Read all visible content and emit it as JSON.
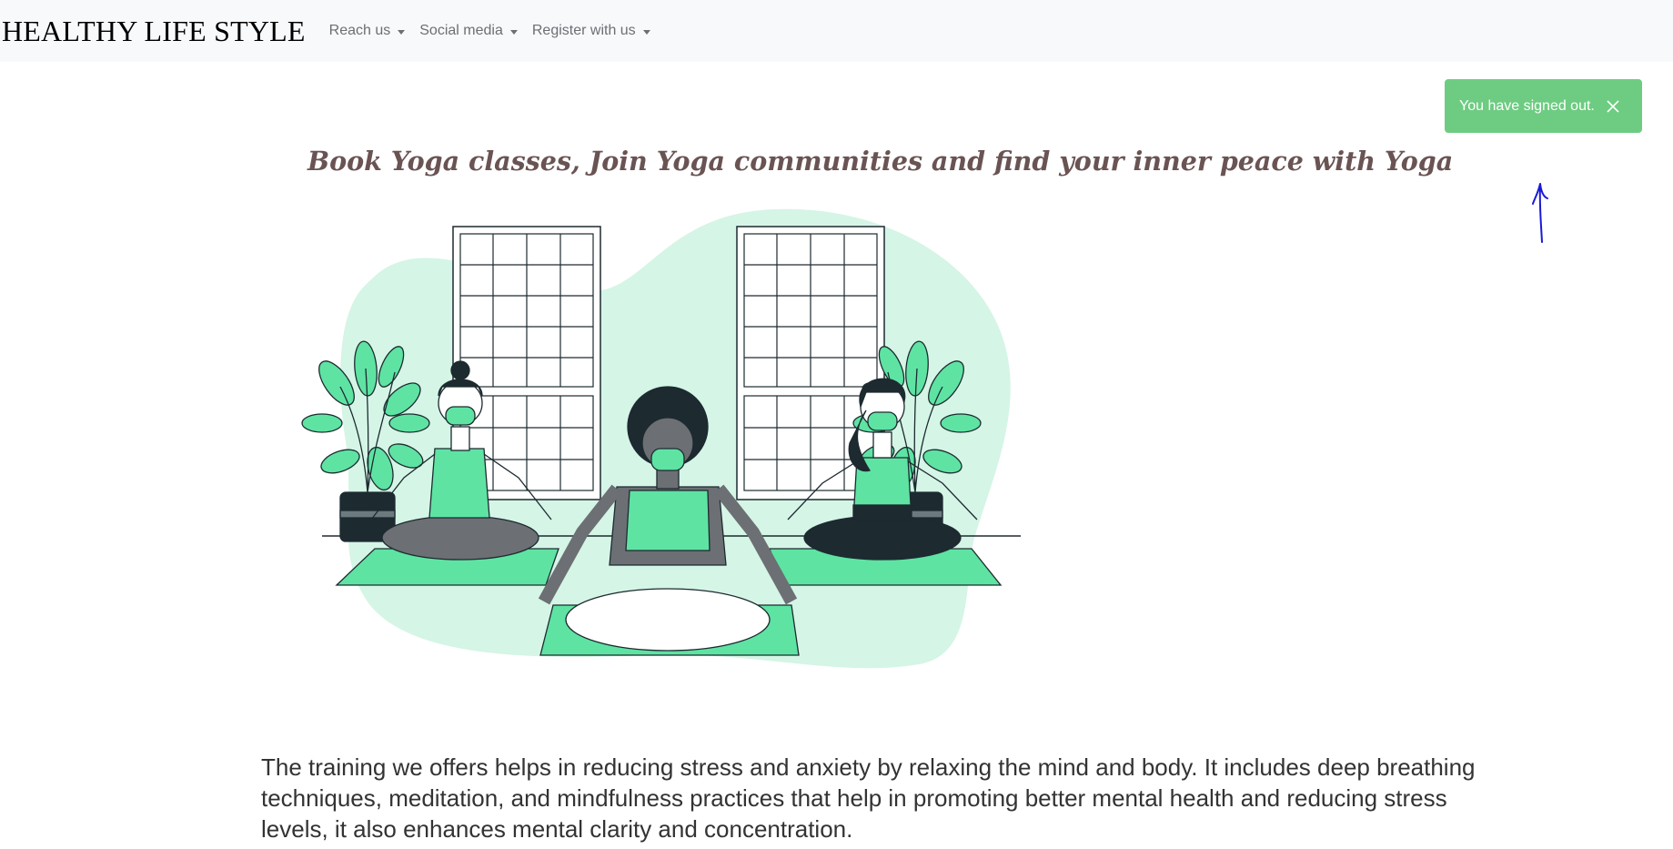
{
  "navbar": {
    "brand": "HEALTHY LIFE STYLE",
    "items": [
      {
        "label": "Reach us"
      },
      {
        "label": "Social media"
      },
      {
        "label": "Register with us"
      }
    ]
  },
  "toast": {
    "message": "You have signed out.",
    "close_icon": "close-icon",
    "background": "#6dcc81"
  },
  "hero": {
    "headline": "Book Yoga classes, Join Yoga communities and find your inner peace with Yoga",
    "illustration_icon": "yoga-illustration",
    "accent_color": "#5ee3a3"
  },
  "description": {
    "text": "The training we offers helps in reducing stress and anxiety by relaxing the mind and body. It includes deep breathing techniques, meditation, and mindfulness practices that help in promoting better mental health and reducing stress levels, it also enhances mental clarity and concentration."
  }
}
